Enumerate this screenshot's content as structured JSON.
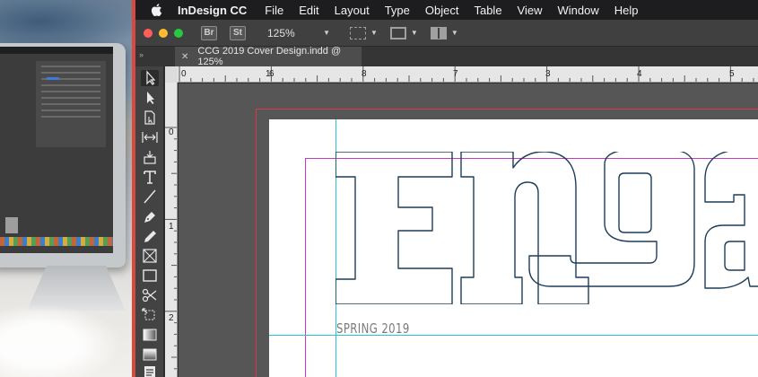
{
  "menubar": {
    "app_name": "InDesign CC",
    "items": [
      "File",
      "Edit",
      "Layout",
      "Type",
      "Object",
      "Table",
      "View",
      "Window",
      "Help"
    ]
  },
  "controlbar": {
    "bridge_label": "Br",
    "stock_label": "St",
    "zoom_value": "125%",
    "traffic_light_colors": [
      "#ff5f57",
      "#febc2e",
      "#28c840"
    ]
  },
  "document": {
    "tab_title": "CCG 2019 Cover Design.indd @ 125%",
    "headline_text": "Enga",
    "subtitle": "SPRING 2019"
  },
  "rulers": {
    "horizontal": [
      "0",
      "1",
      "6",
      "7",
      "8",
      "3",
      "4",
      "5",
      "6"
    ],
    "vertical": [
      "0",
      "1",
      "2"
    ]
  },
  "tools": [
    "selection-tool",
    "direct-selection-tool",
    "page-tool",
    "gap-tool",
    "content-collector-tool",
    "type-tool",
    "line-tool",
    "pen-tool",
    "pencil-tool",
    "rectangle-frame-tool",
    "rectangle-tool",
    "scissors-tool",
    "free-transform-tool",
    "gradient-swatch-tool",
    "gradient-feather-tool",
    "note-tool"
  ],
  "colors": {
    "bleed": "#e0344a",
    "margin": "#c33ac8",
    "guide": "#22c8d8",
    "headline_stroke": "#1c3d5a"
  }
}
